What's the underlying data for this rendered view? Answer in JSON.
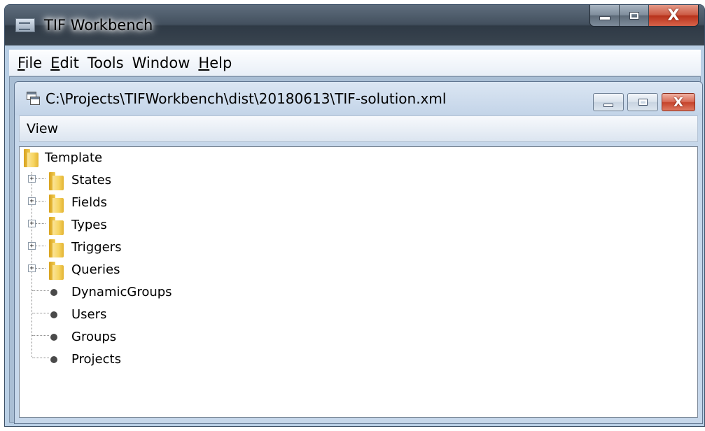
{
  "window": {
    "title": "TIF Workbench",
    "close_glyph": "X"
  },
  "menu": {
    "items": [
      {
        "mnemonic": "F",
        "rest": "ile"
      },
      {
        "mnemonic": "E",
        "rest": "dit"
      },
      {
        "mnemonic": "",
        "rest": "Tools"
      },
      {
        "mnemonic": "",
        "rest": "Window"
      },
      {
        "mnemonic": "H",
        "rest": "elp"
      }
    ]
  },
  "document": {
    "title": "C:\\Projects\\TIFWorkbench\\dist\\20180613\\TIF-solution.xml",
    "close_glyph": "X",
    "view_menu": "View"
  },
  "tree": {
    "root": {
      "label": "Template",
      "icon": "folder-icon"
    },
    "folders": [
      {
        "label": "States",
        "icon": "folder-icon",
        "expander": "+"
      },
      {
        "label": "Fields",
        "icon": "folder-icon",
        "expander": "+"
      },
      {
        "label": "Types",
        "icon": "folder-icon",
        "expander": "+"
      },
      {
        "label": "Triggers",
        "icon": "folder-icon",
        "expander": "+"
      },
      {
        "label": "Queries",
        "icon": "folder-icon",
        "expander": "+"
      }
    ],
    "leaves": [
      {
        "label": "DynamicGroups",
        "icon": "dot-icon"
      },
      {
        "label": "Users",
        "icon": "dot-icon"
      },
      {
        "label": "Groups",
        "icon": "dot-icon"
      },
      {
        "label": "Projects",
        "icon": "dot-icon"
      }
    ]
  }
}
